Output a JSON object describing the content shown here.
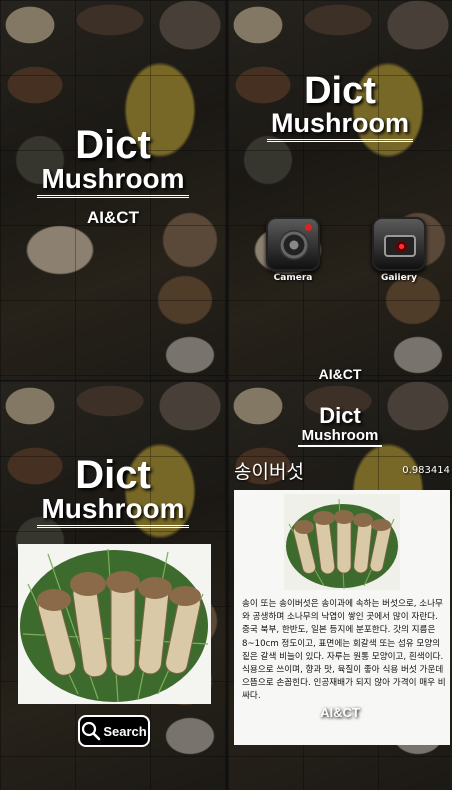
{
  "app": {
    "logo_line1": "Dict",
    "logo_line2": "Mushroom",
    "credit": "AI&CT"
  },
  "screen_splash": {
    "subtitle": "AI&CT"
  },
  "screen_menu": {
    "buttons": [
      {
        "label": "Camera",
        "icon": "camera-icon"
      },
      {
        "label": "Gallery",
        "icon": "gallery-icon"
      }
    ],
    "footer": "AI&CT"
  },
  "screen_search": {
    "search_label": "Search",
    "image_icon": "matsutake-photo"
  },
  "screen_result": {
    "name": "송이버섯",
    "score": "0.983414",
    "description": "송이 또는 송이버섯은 송이과에 속하는 버섯으로, 소나무와 공생하며 소나무의 낙엽이 쌓인 곳에서 많이 자란다. 중국 북부, 한반도, 일본 등지에 분포한다. 갓의 지름은 8~10cm 정도이고, 표면에는 회갈색 또는 섬유 모양의 짙은 갈색 비늘이 있다. 자루는 원통 모양이고, 흰색이다. 식용으로 쓰이며, 향과 맛, 육질이 좋아 식용 버섯 가운데 으뜸으로 손꼽힌다. 인공재배가 되지 않아 가격이 매우 비싸다.",
    "footer": "AI&CT"
  },
  "colors": {
    "background": "#2b2722",
    "text": "#ffffff",
    "card": "#f7f7f5"
  }
}
